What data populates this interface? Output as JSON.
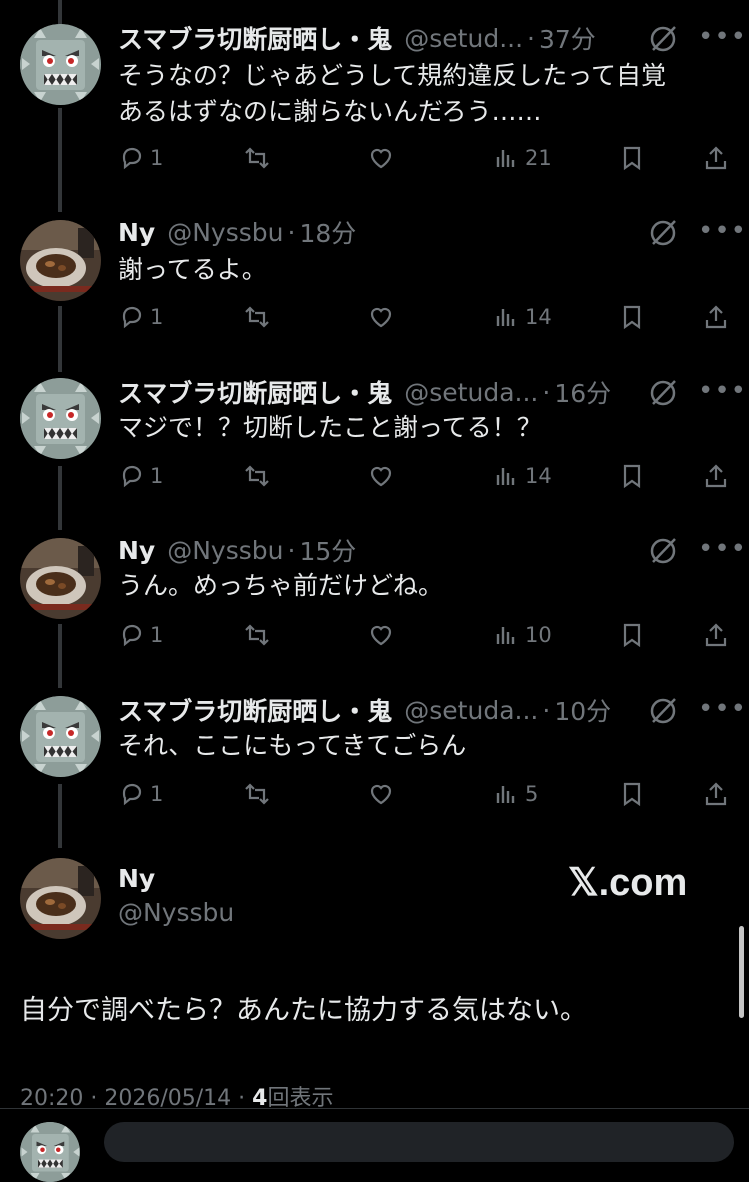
{
  "tweets": [
    {
      "name": "スマブラ切断厨晒し・鬼",
      "handle": "@setud...",
      "time": "37分",
      "lines": [
        "そうなの？じゃあどうして規約違反したって自覚",
        "あるはずなのに謝らないんだろう……"
      ],
      "replies": "1",
      "views": "21"
    },
    {
      "name": "Ny",
      "handle": "@Nyssbu",
      "time": "18分",
      "lines": [
        "謝ってるよ。"
      ],
      "replies": "1",
      "views": "14"
    },
    {
      "name": "スマブラ切断厨晒し・鬼",
      "handle": "@setuda...",
      "time": "16分",
      "lines": [
        "マジで！？切断したこと謝ってる！？"
      ],
      "replies": "1",
      "views": "14"
    },
    {
      "name": "Ny",
      "handle": "@Nyssbu",
      "time": "15分",
      "lines": [
        "うん。めっちゃ前だけどね。"
      ],
      "replies": "1",
      "views": "10"
    },
    {
      "name": "スマブラ切断厨晒し・鬼",
      "handle": "@setuda...",
      "time": "10分",
      "lines": [
        "それ、ここにもってきてごらん"
      ],
      "replies": "1",
      "views": "5"
    }
  ],
  "main": {
    "name": "Ny",
    "handle": "@Nyssbu",
    "text": "自分で調べたら？あんたに協力する気はない。",
    "timestamp": "20:20 · 2026/05/14 · ",
    "views_count": "4",
    "views_label": "回表示"
  },
  "watermark": "𝕏.com",
  "colors": {
    "background": "#000000",
    "text": "#e7e9ea",
    "secondary": "#71767b",
    "thread_line": "#333639"
  },
  "icons": [
    "reply-icon",
    "retweet-icon",
    "like-icon",
    "views-icon",
    "bookmark-icon",
    "share-icon",
    "grok-icon",
    "more-icon"
  ]
}
